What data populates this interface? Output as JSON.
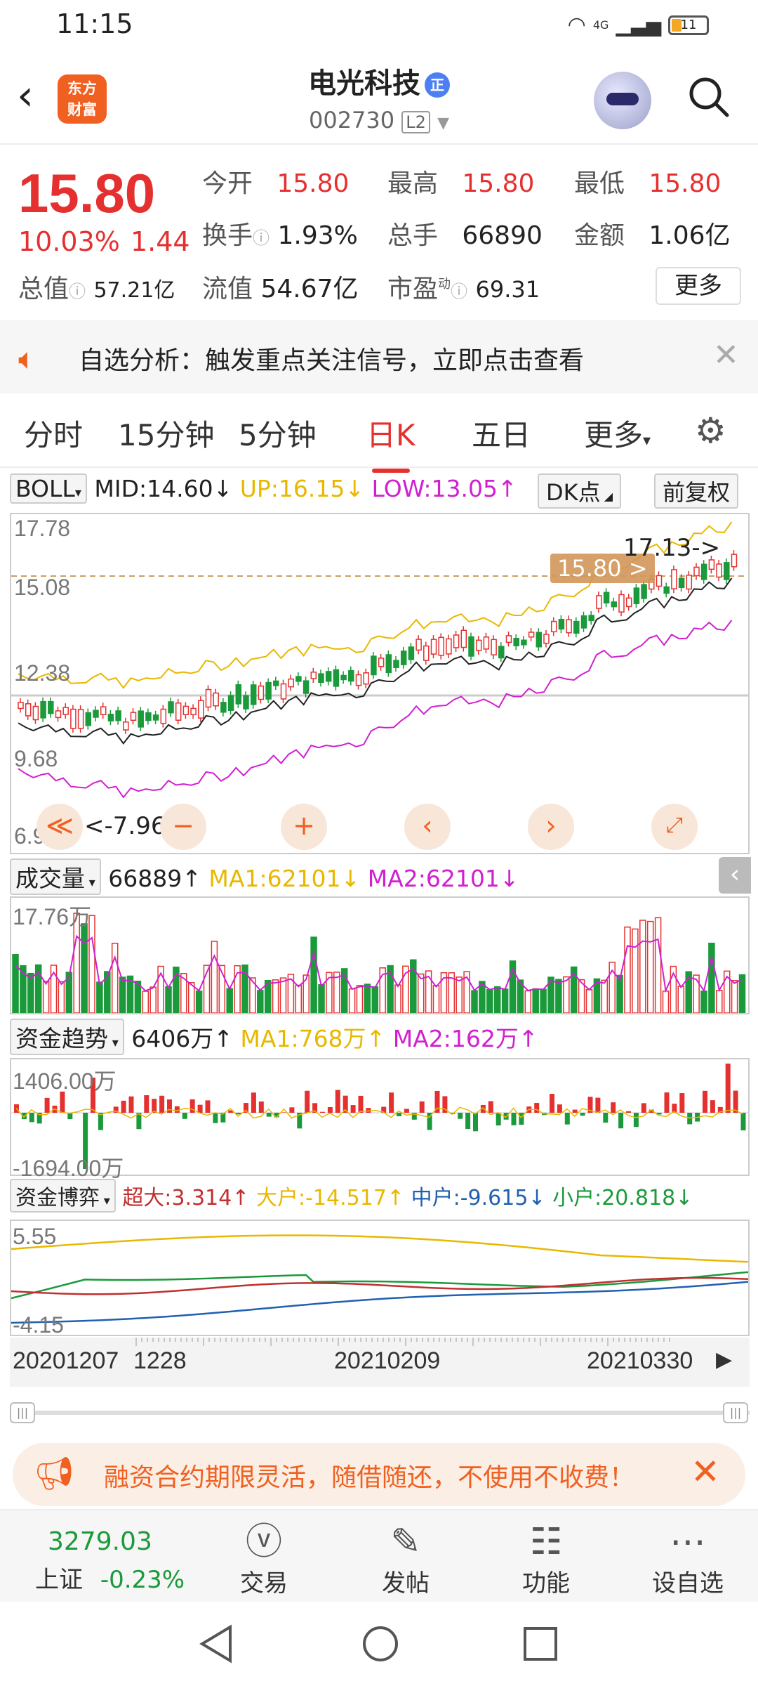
{
  "status": {
    "time": "11:15",
    "network": "4G",
    "battery": "11"
  },
  "header": {
    "logo_text": "东方财富",
    "stock_name": "电光科技",
    "name_badge": "正",
    "stock_code": "002730",
    "level": "L2"
  },
  "quote": {
    "price": "15.80",
    "change_pct": "10.03%",
    "change": "1.44",
    "open_label": "今开",
    "open": "15.80",
    "high_label": "最高",
    "high": "15.80",
    "low_label": "最低",
    "low": "15.80",
    "turnover_label": "换手",
    "turnover": "1.93%",
    "volume_label": "总手",
    "volume": "66890",
    "amount_label": "金额",
    "amount": "1.06亿",
    "mktcap_label": "总值",
    "mktcap": "57.21亿",
    "float_label": "流值",
    "float_cap": "54.67亿",
    "pe_label": "市盈",
    "pe_sup": "动",
    "pe": "69.31",
    "more_label": "更多"
  },
  "notice": {
    "text": "自选分析：触发重点关注信号，立即点击查看"
  },
  "tabs": [
    "分时",
    "15分钟",
    "5分钟",
    "日K",
    "五日",
    "更多"
  ],
  "active_tab": 3,
  "boll": {
    "selector": "BOLL",
    "mid": "MID:14.60↓",
    "up": "UP:16.15↓",
    "low": "LOW:13.05↑",
    "dk": "DK点",
    "adjust": "前复权"
  },
  "kline": {
    "y_labels": [
      "17.78",
      "15.08",
      "12.38",
      "9.68",
      "6.98"
    ],
    "price_tag": "15.80 >",
    "high_mark": "17.13->",
    "low_mark": "<-7.96"
  },
  "volume": {
    "selector": "成交量",
    "value": "66889↑",
    "ma1": "MA1:62101↓",
    "ma2": "MA2:62101↓",
    "y_label": "17.76万"
  },
  "fund_trend": {
    "selector": "资金趋势",
    "value": "6406万↑",
    "ma1": "MA1:768万↑",
    "ma2": "MA2:162万↑",
    "y_top": "1406.00万",
    "y_bottom": "-1694.00万"
  },
  "fund_game": {
    "selector": "资金博弈",
    "super": "超大:3.314↑",
    "large": "大户:-14.517↑",
    "medium": "中户:-9.615↓",
    "small": "小户:20.818↓",
    "y_top": "5.55",
    "y_bottom": "-4.15"
  },
  "dates": [
    "20201207",
    "1228",
    "20210209",
    "20210330"
  ],
  "ad": {
    "text": "融资合约期限灵活，随借随还，不使用不收费！"
  },
  "index": {
    "value": "3279.03",
    "name": "上证",
    "change": "-0.23%"
  },
  "nav": [
    "交易",
    "发帖",
    "功能",
    "设自选"
  ],
  "colors": {
    "up": "#e53030",
    "down": "#1a9a3a",
    "accent": "#f06020",
    "ma_yellow": "#e8b800",
    "ma_magenta": "#d020d0"
  }
}
